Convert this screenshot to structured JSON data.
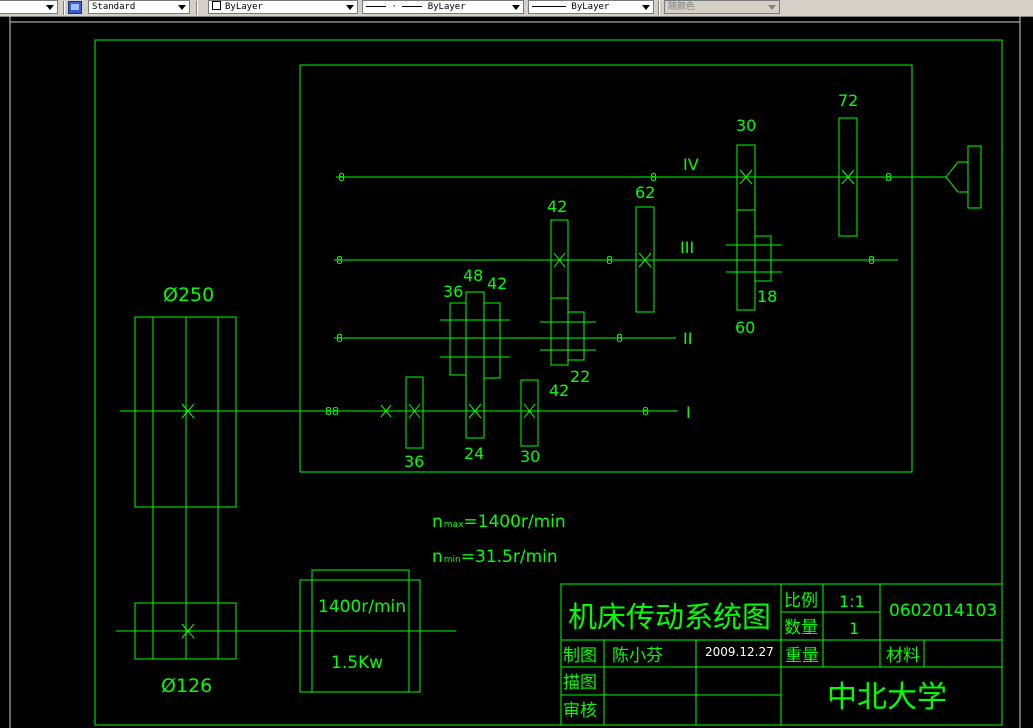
{
  "toolbar": {
    "text_style": "Standard",
    "layer_color": "ByLayer",
    "linetype": "ByLayer",
    "lineweight": "ByLayer",
    "plot_style": "随颜色"
  },
  "drawing": {
    "shaft_labels": {
      "iv": "IV",
      "iii": "III",
      "ii": "II",
      "i": "I"
    },
    "gear_teeth": {
      "g72": "72",
      "g30_top": "30",
      "g62": "62",
      "g42_iii": "42",
      "g36_ii": "36",
      "g48": "48",
      "g42_ii": "42",
      "g18": "18",
      "g60": "60",
      "g22": "22",
      "g42_low": "42",
      "g36_i": "36",
      "g24": "24",
      "g30_i": "30"
    },
    "pulley_big": "Ø250",
    "pulley_small": "Ø126",
    "nmax_sym": "n",
    "nmax_sub": "max",
    "nmax_val": "=1400r/min",
    "nmin_sym": "n",
    "nmin_sub": "min",
    "nmin_val": "=31.5r/min",
    "motor_speed": "1400r/min",
    "motor_power": "1.5Kw"
  },
  "title_block": {
    "title": "机床传动系统图",
    "scale_label": "比例",
    "scale_value": "1:1",
    "qty_label": "数量",
    "qty_value": "1",
    "drawing_no": "0602014103",
    "drawn_label": "制图",
    "drawn_name": "陈小芬",
    "drawn_date": "2009.12.27",
    "weight_label": "重量",
    "material_label": "材料",
    "trace_label": "描图",
    "review_label": "审核",
    "school": "中北大学"
  },
  "colors": {
    "line": "#00ff00",
    "bg": "#000000"
  }
}
